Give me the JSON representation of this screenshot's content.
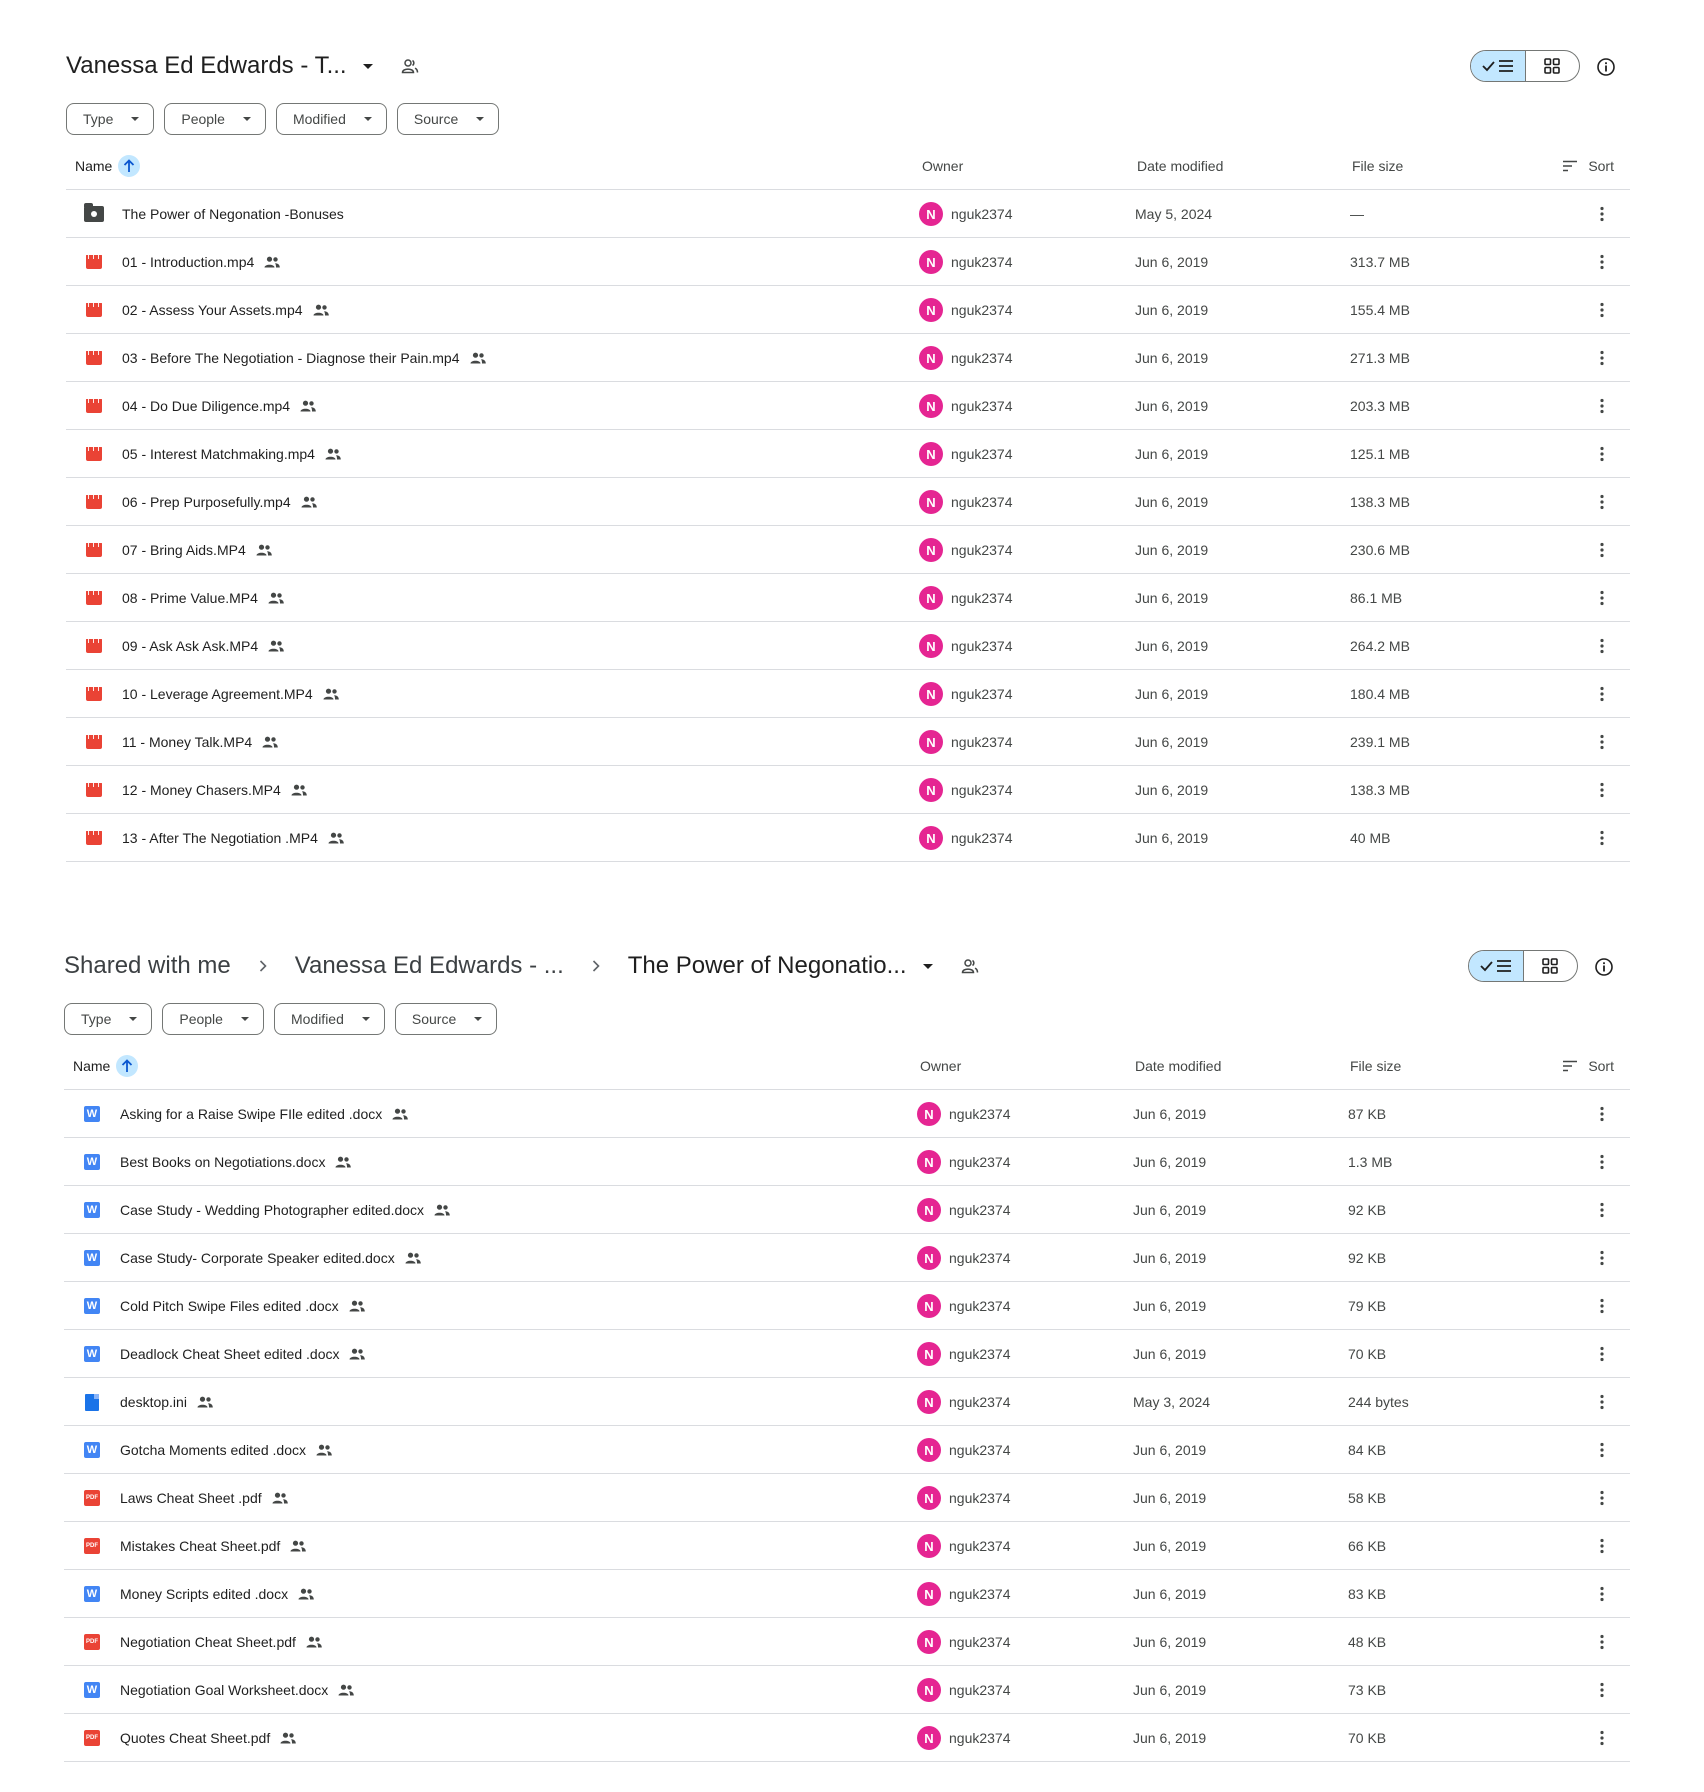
{
  "panel1": {
    "breadcrumbs": [
      {
        "label": "Vanessa Ed Edwards - T..."
      }
    ],
    "filters": [
      "Type",
      "People",
      "Modified",
      "Source"
    ],
    "columns": {
      "name": "Name",
      "owner": "Owner",
      "date": "Date modified",
      "size": "File size",
      "sort": "Sort"
    },
    "rows": [
      {
        "type": "folder",
        "name": "The Power of Negonation -Bonuses",
        "shared": false,
        "owner": "nguk2374",
        "avatar": "N",
        "date": "May 5, 2024",
        "size": "—"
      },
      {
        "type": "video",
        "name": "01 - Introduction.mp4",
        "shared": true,
        "owner": "nguk2374",
        "avatar": "N",
        "date": "Jun 6, 2019",
        "size": "313.7 MB"
      },
      {
        "type": "video",
        "name": "02 - Assess Your Assets.mp4",
        "shared": true,
        "owner": "nguk2374",
        "avatar": "N",
        "date": "Jun 6, 2019",
        "size": "155.4 MB"
      },
      {
        "type": "video",
        "name": "03 - Before The Negotiation - Diagnose their Pain.mp4",
        "shared": true,
        "owner": "nguk2374",
        "avatar": "N",
        "date": "Jun 6, 2019",
        "size": "271.3 MB"
      },
      {
        "type": "video",
        "name": "04 - Do Due Diligence.mp4",
        "shared": true,
        "owner": "nguk2374",
        "avatar": "N",
        "date": "Jun 6, 2019",
        "size": "203.3 MB"
      },
      {
        "type": "video",
        "name": "05 - Interest Matchmaking.mp4",
        "shared": true,
        "owner": "nguk2374",
        "avatar": "N",
        "date": "Jun 6, 2019",
        "size": "125.1 MB"
      },
      {
        "type": "video",
        "name": "06 - Prep Purposefully.mp4",
        "shared": true,
        "owner": "nguk2374",
        "avatar": "N",
        "date": "Jun 6, 2019",
        "size": "138.3 MB"
      },
      {
        "type": "video",
        "name": "07 - Bring Aids.MP4",
        "shared": true,
        "owner": "nguk2374",
        "avatar": "N",
        "date": "Jun 6, 2019",
        "size": "230.6 MB"
      },
      {
        "type": "video",
        "name": "08 - Prime Value.MP4",
        "shared": true,
        "owner": "nguk2374",
        "avatar": "N",
        "date": "Jun 6, 2019",
        "size": "86.1 MB"
      },
      {
        "type": "video",
        "name": "09 - Ask Ask Ask.MP4",
        "shared": true,
        "owner": "nguk2374",
        "avatar": "N",
        "date": "Jun 6, 2019",
        "size": "264.2 MB"
      },
      {
        "type": "video",
        "name": "10 - Leverage Agreement.MP4",
        "shared": true,
        "owner": "nguk2374",
        "avatar": "N",
        "date": "Jun 6, 2019",
        "size": "180.4 MB"
      },
      {
        "type": "video",
        "name": "11 - Money Talk.MP4",
        "shared": true,
        "owner": "nguk2374",
        "avatar": "N",
        "date": "Jun 6, 2019",
        "size": "239.1 MB"
      },
      {
        "type": "video",
        "name": "12 - Money Chasers.MP4",
        "shared": true,
        "owner": "nguk2374",
        "avatar": "N",
        "date": "Jun 6, 2019",
        "size": "138.3 MB"
      },
      {
        "type": "video",
        "name": "13 - After The Negotiation .MP4",
        "shared": true,
        "owner": "nguk2374",
        "avatar": "N",
        "date": "Jun 6, 2019",
        "size": "40 MB"
      }
    ]
  },
  "panel2": {
    "breadcrumbs": [
      {
        "label": "Shared with me"
      },
      {
        "label": "Vanessa Ed Edwards - ..."
      },
      {
        "label": "The Power of Negonatio..."
      }
    ],
    "filters": [
      "Type",
      "People",
      "Modified",
      "Source"
    ],
    "columns": {
      "name": "Name",
      "owner": "Owner",
      "date": "Date modified",
      "size": "File size",
      "sort": "Sort"
    },
    "rows": [
      {
        "type": "word",
        "name": "Asking for a Raise Swipe FIle edited .docx",
        "shared": true,
        "owner": "nguk2374",
        "avatar": "N",
        "date": "Jun 6, 2019",
        "size": "87 KB"
      },
      {
        "type": "word",
        "name": "Best Books on Negotiations.docx",
        "shared": true,
        "owner": "nguk2374",
        "avatar": "N",
        "date": "Jun 6, 2019",
        "size": "1.3 MB"
      },
      {
        "type": "word",
        "name": "Case Study - Wedding Photographer edited.docx",
        "shared": true,
        "owner": "nguk2374",
        "avatar": "N",
        "date": "Jun 6, 2019",
        "size": "92 KB"
      },
      {
        "type": "word",
        "name": "Case Study- Corporate Speaker edited.docx",
        "shared": true,
        "owner": "nguk2374",
        "avatar": "N",
        "date": "Jun 6, 2019",
        "size": "92 KB"
      },
      {
        "type": "word",
        "name": "Cold Pitch Swipe Files edited .docx",
        "shared": true,
        "owner": "nguk2374",
        "avatar": "N",
        "date": "Jun 6, 2019",
        "size": "79 KB"
      },
      {
        "type": "word",
        "name": "Deadlock Cheat Sheet edited .docx",
        "shared": true,
        "owner": "nguk2374",
        "avatar": "N",
        "date": "Jun 6, 2019",
        "size": "70 KB"
      },
      {
        "type": "file",
        "name": "desktop.ini",
        "shared": true,
        "owner": "nguk2374",
        "avatar": "N",
        "date": "May 3, 2024",
        "size": "244 bytes"
      },
      {
        "type": "word",
        "name": "Gotcha Moments edited .docx",
        "shared": true,
        "owner": "nguk2374",
        "avatar": "N",
        "date": "Jun 6, 2019",
        "size": "84 KB"
      },
      {
        "type": "pdf",
        "name": "Laws Cheat Sheet .pdf",
        "shared": true,
        "owner": "nguk2374",
        "avatar": "N",
        "date": "Jun 6, 2019",
        "size": "58 KB"
      },
      {
        "type": "pdf",
        "name": "Mistakes Cheat Sheet.pdf",
        "shared": true,
        "owner": "nguk2374",
        "avatar": "N",
        "date": "Jun 6, 2019",
        "size": "66 KB"
      },
      {
        "type": "word",
        "name": "Money Scripts edited .docx",
        "shared": true,
        "owner": "nguk2374",
        "avatar": "N",
        "date": "Jun 6, 2019",
        "size": "83 KB"
      },
      {
        "type": "pdf",
        "name": "Negotiation Cheat Sheet.pdf",
        "shared": true,
        "owner": "nguk2374",
        "avatar": "N",
        "date": "Jun 6, 2019",
        "size": "48 KB"
      },
      {
        "type": "word",
        "name": "Negotiation Goal Worksheet.docx",
        "shared": true,
        "owner": "nguk2374",
        "avatar": "N",
        "date": "Jun 6, 2019",
        "size": "73 KB"
      },
      {
        "type": "pdf",
        "name": "Quotes Cheat Sheet.pdf",
        "shared": true,
        "owner": "nguk2374",
        "avatar": "N",
        "date": "Jun 6, 2019",
        "size": "70 KB"
      }
    ]
  },
  "icons": {
    "view_list": "check-list-icon",
    "view_grid": "grid-icon",
    "info": "info-icon",
    "shared": "people-icon",
    "more": "more-vert-icon",
    "sort": "sort-lines-icon",
    "sort_direction": "arrow-up-icon"
  },
  "colors": {
    "accent": "#c2e7ff",
    "avatar": "#e52592",
    "word": "#4285f4",
    "pdf": "#ea4335",
    "video": "#ea4335",
    "file": "#1a73e8"
  }
}
